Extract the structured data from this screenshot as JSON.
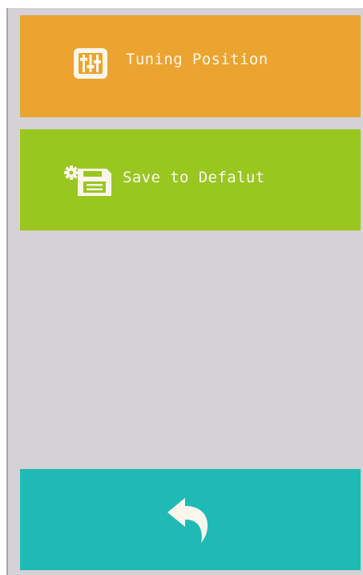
{
  "colors": {
    "background": "#d5d2d5",
    "tuning_tile": "#eba430",
    "save_tile": "#99c720",
    "back_tile": "#1fbab5",
    "text": "#fbf6ec"
  },
  "menu": {
    "tuning": {
      "label": "Tuning Position",
      "icon": "equalizer-sliders-icon"
    },
    "save": {
      "label": "Save to Defalut",
      "icon": "save-settings-icon"
    }
  },
  "footer": {
    "back_icon": "back-arrow-icon"
  }
}
